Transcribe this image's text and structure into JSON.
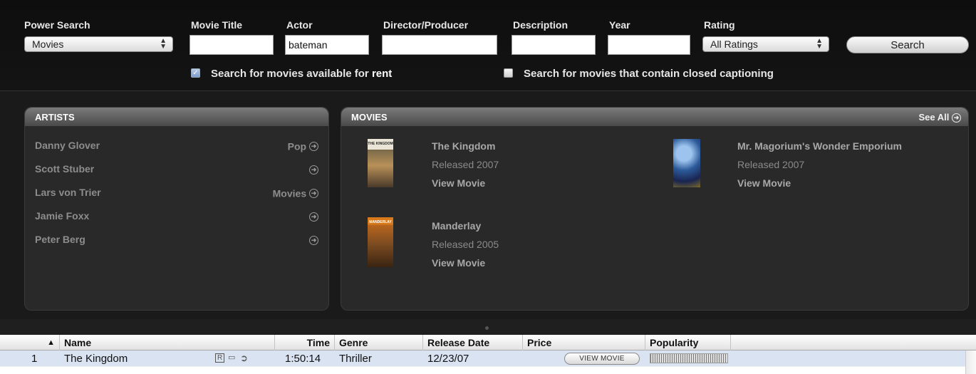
{
  "search": {
    "power_search_label": "Power Search",
    "power_search_value": "Movies",
    "movie_title_label": "Movie Title",
    "movie_title_value": "",
    "actor_label": "Actor",
    "actor_value": "bateman",
    "director_label": "Director/Producer",
    "director_value": "",
    "description_label": "Description",
    "description_value": "",
    "year_label": "Year",
    "year_value": "",
    "rating_label": "Rating",
    "rating_value": "All Ratings",
    "search_button": "Search",
    "rent_checkbox_prefix": "Search for movies available for",
    "rent_checkbox_emph": "rent",
    "rent_checked": true,
    "cc_checkbox_label": "Search for movies that contain closed captioning",
    "cc_checked": false
  },
  "artists_panel": {
    "title": "ARTISTS",
    "items": [
      {
        "name": "Danny Glover",
        "genre": "Pop"
      },
      {
        "name": "Scott Stuber",
        "genre": ""
      },
      {
        "name": "Lars von Trier",
        "genre": "Movies"
      },
      {
        "name": "Jamie Foxx",
        "genre": ""
      },
      {
        "name": "Peter Berg",
        "genre": ""
      }
    ]
  },
  "movies_panel": {
    "title": "MOVIES",
    "see_all": "See All",
    "items": [
      {
        "title": "The Kingdom",
        "released": "Released 2007",
        "view": "View Movie",
        "poster_text": "THE KINGDOM"
      },
      {
        "title": "Mr. Magorium's Wonder Emporium",
        "released": "Released 2007",
        "view": "View Movie",
        "poster_text": ""
      },
      {
        "title": "Manderlay",
        "released": "Released 2005",
        "view": "View Movie",
        "poster_text": "MANDERLAY"
      }
    ]
  },
  "table": {
    "columns": [
      "Name",
      "Time",
      "Genre",
      "Release Date",
      "Price",
      "Popularity"
    ],
    "rows": [
      {
        "index": "1",
        "name": "The Kingdom",
        "rating_badge": "R",
        "time": "1:50:14",
        "genre": "Thriller",
        "release_date": "12/23/07",
        "price_button": "VIEW MOVIE",
        "popularity": 1.0
      }
    ]
  },
  "colors": {
    "panel_bg": "#292929",
    "header_bg": "#111111",
    "selected_row": "#d9e3f2"
  }
}
